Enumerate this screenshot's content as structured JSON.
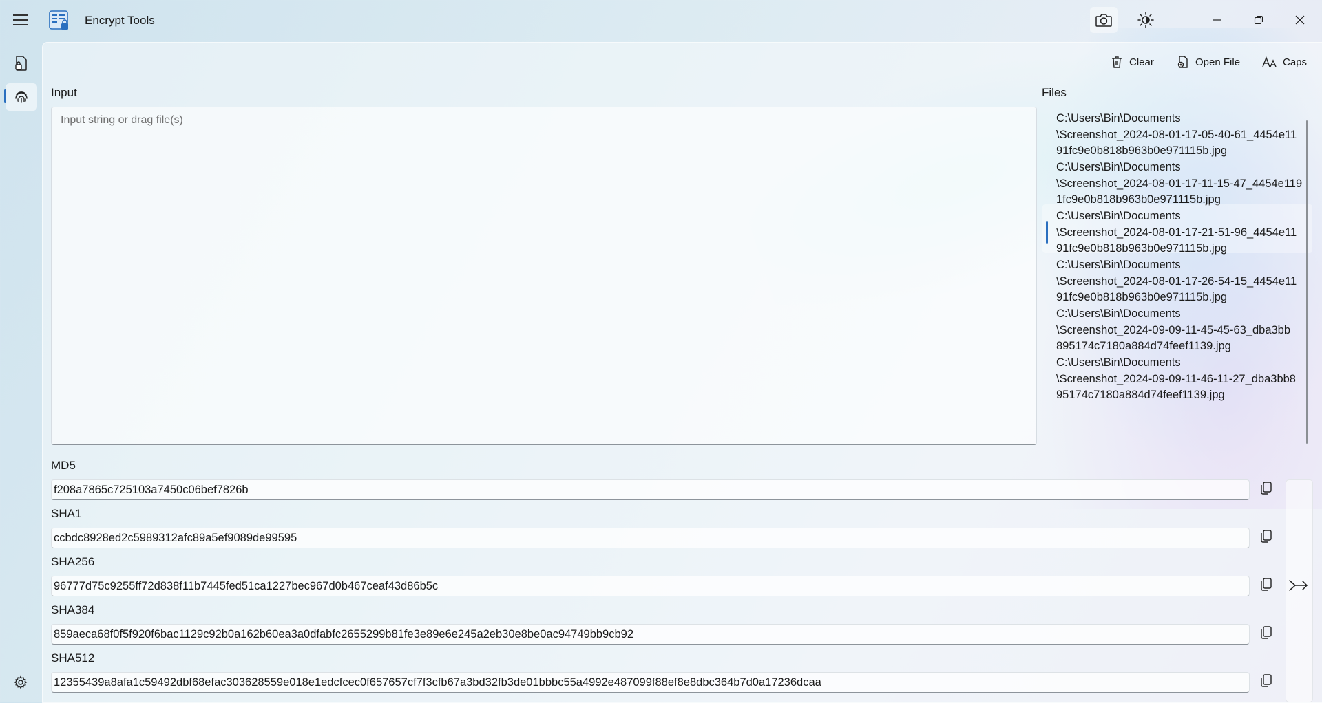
{
  "app": {
    "title": "Encrypt Tools"
  },
  "toolbar": {
    "clear_label": "Clear",
    "open_file_label": "Open File",
    "caps_label": "Caps"
  },
  "input": {
    "label": "Input",
    "placeholder": "Input string or drag file(s)"
  },
  "files": {
    "label": "Files",
    "items": [
      {
        "path": "C:\\Users\\Bin\\Documents\\Screenshot_2024-08-01-17-05-40-61_4454e1191fc9e0b818b963b0e971115b.jpg",
        "lines": [
          "C:\\Users\\Bin\\Documents",
          "\\Screenshot_2024-08-01-17-05-40-61_4454e11",
          "91fc9e0b818b963b0e971115b.jpg"
        ]
      },
      {
        "path": "C:\\Users\\Bin\\Documents\\Screenshot_2024-08-01-17-11-15-47_4454e1191fc9e0b818b963b0e971115b.jpg",
        "lines": [
          "C:\\Users\\Bin\\Documents",
          "\\Screenshot_2024-08-01-17-11-15-47_4454e119",
          "1fc9e0b818b963b0e971115b.jpg"
        ]
      },
      {
        "path": "C:\\Users\\Bin\\Documents\\Screenshot_2024-08-01-17-21-51-96_4454e1191fc9e0b818b963b0e971115b.jpg",
        "lines": [
          "C:\\Users\\Bin\\Documents",
          "\\Screenshot_2024-08-01-17-21-51-96_4454e11",
          "91fc9e0b818b963b0e971115b.jpg"
        ],
        "selected": true
      },
      {
        "path": "C:\\Users\\Bin\\Documents\\Screenshot_2024-08-01-17-26-54-15_4454e1191fc9e0b818b963b0e971115b.jpg",
        "lines": [
          "C:\\Users\\Bin\\Documents",
          "\\Screenshot_2024-08-01-17-26-54-15_4454e11",
          "91fc9e0b818b963b0e971115b.jpg"
        ]
      },
      {
        "path": "C:\\Users\\Bin\\Documents\\Screenshot_2024-09-09-11-45-45-63_dba3bb895174c7180a884d74feef1139.jpg",
        "lines": [
          "C:\\Users\\Bin\\Documents",
          "\\Screenshot_2024-09-09-11-45-45-63_dba3bb",
          "895174c7180a884d74feef1139.jpg"
        ]
      },
      {
        "path": "C:\\Users\\Bin\\Documents\\Screenshot_2024-09-09-11-46-11-27_dba3bb895174c7180a884d74feef1139.jpg",
        "lines": [
          "C:\\Users\\Bin\\Documents",
          "\\Screenshot_2024-09-09-11-46-11-27_dba3bb8",
          "95174c7180a884d74feef1139.jpg"
        ]
      }
    ]
  },
  "hashes": [
    {
      "label": "MD5",
      "value": "f208a7865c725103a7450c06bef7826b"
    },
    {
      "label": "SHA1",
      "value": "ccbdc8928ed2c5989312afc89a5ef9089de99595"
    },
    {
      "label": "SHA256",
      "value": "96777d75c9255ff72d838f11b7445fed51ca1227bec967d0b467ceaf43d86b5c"
    },
    {
      "label": "SHA384",
      "value": "859aeca68f0f5f920f6bac1129c92b0a162b60ea3a0dfabfc2655299b81fe3e89e6e245a2eb30e8be0ac94749bb9cb92"
    },
    {
      "label": "SHA512",
      "value": "12355439a8afa1c59492dbf68efac303628559e018e1edcfcec0f657657cf7f3cfb67a3bd32fb3de01bbbc55a4992e487099f88ef8e8dbc364b7d0a17236dcaa"
    }
  ],
  "icons": {
    "menu": "hamburger-icon",
    "app": "app-logo-icon",
    "camera": "camera-icon",
    "theme": "brightness-icon",
    "minimize": "minimize-icon",
    "maximize": "restore-icon",
    "close": "close-icon",
    "nav_file": "file-lock-icon",
    "nav_hash": "fingerprint-icon",
    "settings": "gear-icon",
    "clear": "trash-icon",
    "open_file": "open-file-icon",
    "caps": "font-size-icon",
    "copy": "copy-icon",
    "go": "arrow-right-icon"
  },
  "colors": {
    "accent": "#2a6fbf",
    "text": "#1b1b1b",
    "placeholder": "#6f6f6f"
  }
}
